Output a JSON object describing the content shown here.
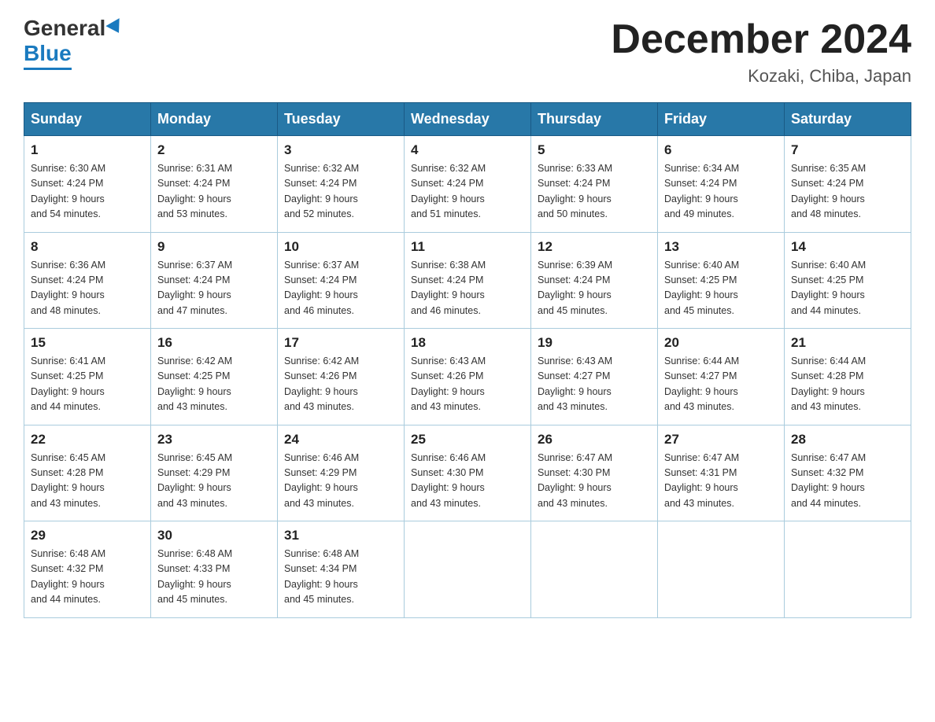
{
  "header": {
    "logo_general": "General",
    "logo_blue": "Blue",
    "title": "December 2024",
    "subtitle": "Kozaki, Chiba, Japan"
  },
  "days_of_week": [
    "Sunday",
    "Monday",
    "Tuesday",
    "Wednesday",
    "Thursday",
    "Friday",
    "Saturday"
  ],
  "weeks": [
    [
      {
        "day": "1",
        "sunrise": "6:30 AM",
        "sunset": "4:24 PM",
        "daylight": "9 hours and 54 minutes."
      },
      {
        "day": "2",
        "sunrise": "6:31 AM",
        "sunset": "4:24 PM",
        "daylight": "9 hours and 53 minutes."
      },
      {
        "day": "3",
        "sunrise": "6:32 AM",
        "sunset": "4:24 PM",
        "daylight": "9 hours and 52 minutes."
      },
      {
        "day": "4",
        "sunrise": "6:32 AM",
        "sunset": "4:24 PM",
        "daylight": "9 hours and 51 minutes."
      },
      {
        "day": "5",
        "sunrise": "6:33 AM",
        "sunset": "4:24 PM",
        "daylight": "9 hours and 50 minutes."
      },
      {
        "day": "6",
        "sunrise": "6:34 AM",
        "sunset": "4:24 PM",
        "daylight": "9 hours and 49 minutes."
      },
      {
        "day": "7",
        "sunrise": "6:35 AM",
        "sunset": "4:24 PM",
        "daylight": "9 hours and 48 minutes."
      }
    ],
    [
      {
        "day": "8",
        "sunrise": "6:36 AM",
        "sunset": "4:24 PM",
        "daylight": "9 hours and 48 minutes."
      },
      {
        "day": "9",
        "sunrise": "6:37 AM",
        "sunset": "4:24 PM",
        "daylight": "9 hours and 47 minutes."
      },
      {
        "day": "10",
        "sunrise": "6:37 AM",
        "sunset": "4:24 PM",
        "daylight": "9 hours and 46 minutes."
      },
      {
        "day": "11",
        "sunrise": "6:38 AM",
        "sunset": "4:24 PM",
        "daylight": "9 hours and 46 minutes."
      },
      {
        "day": "12",
        "sunrise": "6:39 AM",
        "sunset": "4:24 PM",
        "daylight": "9 hours and 45 minutes."
      },
      {
        "day": "13",
        "sunrise": "6:40 AM",
        "sunset": "4:25 PM",
        "daylight": "9 hours and 45 minutes."
      },
      {
        "day": "14",
        "sunrise": "6:40 AM",
        "sunset": "4:25 PM",
        "daylight": "9 hours and 44 minutes."
      }
    ],
    [
      {
        "day": "15",
        "sunrise": "6:41 AM",
        "sunset": "4:25 PM",
        "daylight": "9 hours and 44 minutes."
      },
      {
        "day": "16",
        "sunrise": "6:42 AM",
        "sunset": "4:25 PM",
        "daylight": "9 hours and 43 minutes."
      },
      {
        "day": "17",
        "sunrise": "6:42 AM",
        "sunset": "4:26 PM",
        "daylight": "9 hours and 43 minutes."
      },
      {
        "day": "18",
        "sunrise": "6:43 AM",
        "sunset": "4:26 PM",
        "daylight": "9 hours and 43 minutes."
      },
      {
        "day": "19",
        "sunrise": "6:43 AM",
        "sunset": "4:27 PM",
        "daylight": "9 hours and 43 minutes."
      },
      {
        "day": "20",
        "sunrise": "6:44 AM",
        "sunset": "4:27 PM",
        "daylight": "9 hours and 43 minutes."
      },
      {
        "day": "21",
        "sunrise": "6:44 AM",
        "sunset": "4:28 PM",
        "daylight": "9 hours and 43 minutes."
      }
    ],
    [
      {
        "day": "22",
        "sunrise": "6:45 AM",
        "sunset": "4:28 PM",
        "daylight": "9 hours and 43 minutes."
      },
      {
        "day": "23",
        "sunrise": "6:45 AM",
        "sunset": "4:29 PM",
        "daylight": "9 hours and 43 minutes."
      },
      {
        "day": "24",
        "sunrise": "6:46 AM",
        "sunset": "4:29 PM",
        "daylight": "9 hours and 43 minutes."
      },
      {
        "day": "25",
        "sunrise": "6:46 AM",
        "sunset": "4:30 PM",
        "daylight": "9 hours and 43 minutes."
      },
      {
        "day": "26",
        "sunrise": "6:47 AM",
        "sunset": "4:30 PM",
        "daylight": "9 hours and 43 minutes."
      },
      {
        "day": "27",
        "sunrise": "6:47 AM",
        "sunset": "4:31 PM",
        "daylight": "9 hours and 43 minutes."
      },
      {
        "day": "28",
        "sunrise": "6:47 AM",
        "sunset": "4:32 PM",
        "daylight": "9 hours and 44 minutes."
      }
    ],
    [
      {
        "day": "29",
        "sunrise": "6:48 AM",
        "sunset": "4:32 PM",
        "daylight": "9 hours and 44 minutes."
      },
      {
        "day": "30",
        "sunrise": "6:48 AM",
        "sunset": "4:33 PM",
        "daylight": "9 hours and 45 minutes."
      },
      {
        "day": "31",
        "sunrise": "6:48 AM",
        "sunset": "4:34 PM",
        "daylight": "9 hours and 45 minutes."
      },
      null,
      null,
      null,
      null
    ]
  ],
  "labels": {
    "sunrise": "Sunrise:",
    "sunset": "Sunset:",
    "daylight": "Daylight:"
  }
}
